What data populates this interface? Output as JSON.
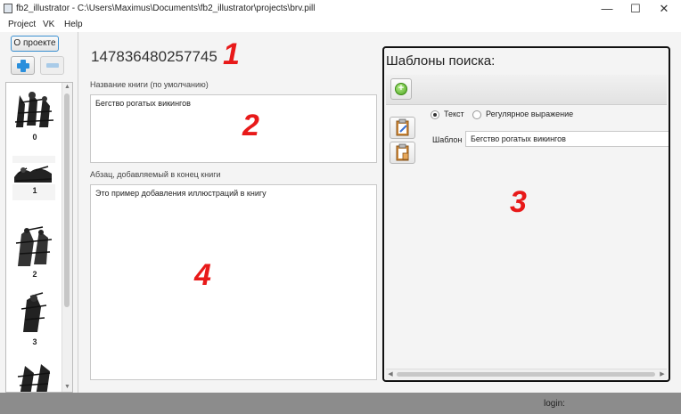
{
  "window": {
    "title": "fb2_illustrator - C:\\Users\\Maximus\\Documents\\fb2_illustrator\\projects\\brv.pill",
    "minimize": "—",
    "maximize": "☐",
    "close": "✕"
  },
  "menu": [
    "Project",
    "VK",
    "Help"
  ],
  "left": {
    "about_label": "О проекте",
    "thumbnails": [
      {
        "caption": "0"
      },
      {
        "caption": "1"
      },
      {
        "caption": "2"
      },
      {
        "caption": "3"
      }
    ]
  },
  "center": {
    "book_id": "147836480257745",
    "book_title_label": "Название книги (по умолчанию)",
    "book_title_value": "Бегство рогатых викингов",
    "paragraph_label": "Абзац, добавляемый в конец книги",
    "paragraph_value": "Это пример добавления иллюстраций в книгу"
  },
  "search_templates": {
    "title": "Шаблоны поиска:",
    "radio_text": "Текст",
    "radio_regex": "Регулярное выражение",
    "selected": "text",
    "template_label": "Шаблон",
    "template_value": "Бегство рогатых викингов"
  },
  "markers": [
    "1",
    "2",
    "3",
    "4"
  ],
  "status": {
    "login_label": "login:"
  },
  "colors": {
    "marker": "#e81919",
    "accent": "#2a8fdc",
    "statusbar": "#8c8c8c"
  }
}
